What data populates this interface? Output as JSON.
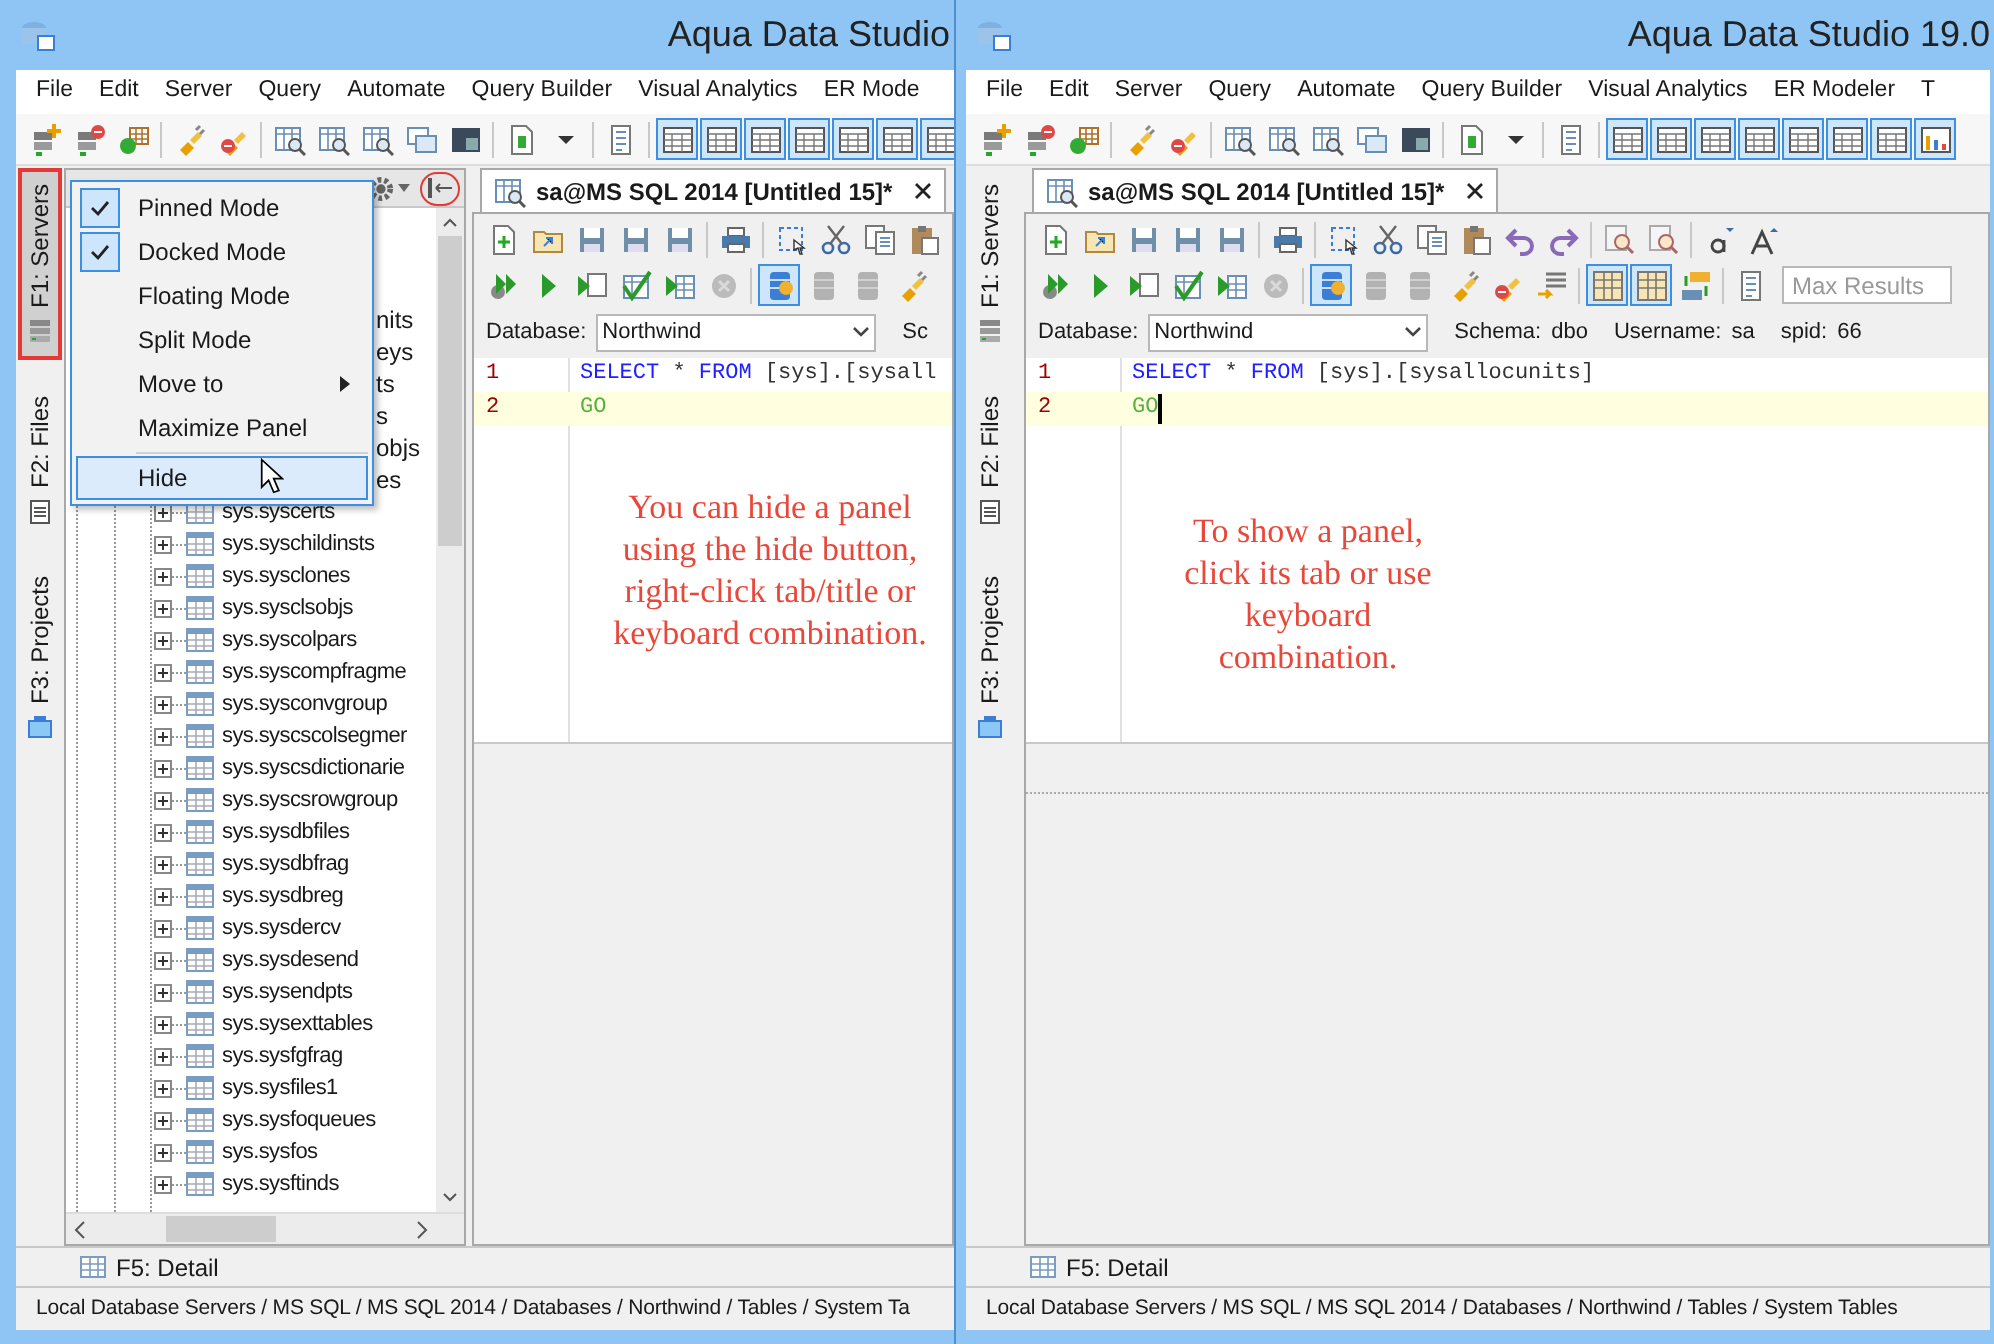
{
  "windows": [
    {
      "title": "Aqua Data Studio",
      "menu": [
        "File",
        "Edit",
        "Server",
        "Query",
        "Automate",
        "Query Builder",
        "Visual Analytics",
        "ER Mode"
      ],
      "toolbar": [
        {
          "kind": "server-add",
          "pressed": false
        },
        {
          "kind": "server-remove",
          "pressed": false
        },
        {
          "kind": "table-add",
          "pressed": false
        },
        {
          "kind": "separator"
        },
        {
          "kind": "connect",
          "pressed": false
        },
        {
          "kind": "disconnect",
          "pressed": false
        },
        {
          "kind": "separator"
        },
        {
          "kind": "query",
          "pressed": false
        },
        {
          "kind": "query",
          "pressed": false
        },
        {
          "kind": "query",
          "pressed": false
        },
        {
          "kind": "windows",
          "pressed": false
        },
        {
          "kind": "console",
          "pressed": false
        },
        {
          "kind": "separator"
        },
        {
          "kind": "document",
          "pressed": false
        },
        {
          "kind": "caret",
          "pressed": false
        },
        {
          "kind": "separator"
        },
        {
          "kind": "script",
          "pressed": false
        },
        {
          "kind": "separator"
        },
        {
          "kind": "layout",
          "pressed": true
        },
        {
          "kind": "layout",
          "pressed": true
        },
        {
          "kind": "layout",
          "pressed": true
        },
        {
          "kind": "layout",
          "pressed": true
        },
        {
          "kind": "layout",
          "pressed": true
        },
        {
          "kind": "layout",
          "pressed": true
        },
        {
          "kind": "layout",
          "pressed": true
        }
      ],
      "side_tabs": [
        {
          "label": "F1: Servers",
          "kind": "servers",
          "selected": true,
          "highlighted": true
        },
        {
          "label": "F2: Files",
          "kind": "files",
          "selected": false,
          "highlighted": false
        },
        {
          "label": "F3: Projects",
          "kind": "projects",
          "selected": false,
          "highlighted": false
        }
      ],
      "panel": {
        "hide_button": {
          "highlighted": true
        },
        "context_menu": [
          {
            "kind": "item",
            "label": "Pinned Mode",
            "checked": true,
            "selected": false
          },
          {
            "kind": "item",
            "label": "Docked Mode",
            "checked": true,
            "selected": false
          },
          {
            "kind": "item",
            "label": "Floating Mode",
            "checked": false,
            "selected": false
          },
          {
            "kind": "item",
            "label": "Split Mode",
            "checked": false,
            "selected": false
          },
          {
            "kind": "submenu",
            "label": "Move to",
            "checked": false,
            "selected": false
          },
          {
            "kind": "item",
            "label": "Maximize Panel",
            "checked": false,
            "selected": false
          },
          {
            "kind": "separator"
          },
          {
            "kind": "item",
            "label": "Hide",
            "checked": false,
            "selected": true
          }
        ],
        "tree": [
          {
            "kind": "clipped",
            "text": "nits"
          },
          {
            "kind": "clipped",
            "text": "eys"
          },
          {
            "kind": "clipped",
            "text": "ts"
          },
          {
            "kind": "clipped",
            "text": "s"
          },
          {
            "kind": "clipped",
            "text": "objs"
          },
          {
            "kind": "clipped",
            "text": "es"
          },
          {
            "kind": "table",
            "text": "sys.syscerts",
            "expanded": false
          },
          {
            "kind": "table",
            "text": "sys.syschildinsts",
            "expanded": false
          },
          {
            "kind": "table",
            "text": "sys.sysclones",
            "expanded": false
          },
          {
            "kind": "table",
            "text": "sys.sysclsobjs",
            "expanded": false
          },
          {
            "kind": "table",
            "text": "sys.syscolpars",
            "expanded": false
          },
          {
            "kind": "table",
            "text": "sys.syscompfragme",
            "expanded": false
          },
          {
            "kind": "table",
            "text": "sys.sysconvgroup",
            "expanded": false
          },
          {
            "kind": "table",
            "text": "sys.syscscolsegmer",
            "expanded": false
          },
          {
            "kind": "table",
            "text": "sys.syscsdictionarie",
            "expanded": false
          },
          {
            "kind": "table",
            "text": "sys.syscsrowgroup",
            "expanded": false
          },
          {
            "kind": "table",
            "text": "sys.sysdbfiles",
            "expanded": false
          },
          {
            "kind": "table",
            "text": "sys.sysdbfrag",
            "expanded": false
          },
          {
            "kind": "table",
            "text": "sys.sysdbreg",
            "expanded": false
          },
          {
            "kind": "table",
            "text": "sys.sysdercv",
            "expanded": false
          },
          {
            "kind": "table",
            "text": "sys.sysdesend",
            "expanded": false
          },
          {
            "kind": "table",
            "text": "sys.sysendpts",
            "expanded": false
          },
          {
            "kind": "table",
            "text": "sys.sysexttables",
            "expanded": false
          },
          {
            "kind": "table",
            "text": "sys.sysfgfrag",
            "expanded": false
          },
          {
            "kind": "table",
            "text": "sys.sysfiles1",
            "expanded": false
          },
          {
            "kind": "table",
            "text": "sys.sysfoqueues",
            "expanded": false
          },
          {
            "kind": "table",
            "text": "sys.sysfos",
            "expanded": false
          },
          {
            "kind": "table",
            "text": "sys.sysftinds",
            "expanded": false
          }
        ]
      },
      "editor": {
        "tab": "sa@MS SQL 2014 [Untitled 15]*",
        "toolbar_1": [
          {
            "kind": "file-add"
          },
          {
            "kind": "folder"
          },
          {
            "kind": "save"
          },
          {
            "kind": "save"
          },
          {
            "kind": "save"
          },
          {
            "kind": "separator"
          },
          {
            "kind": "print"
          },
          {
            "kind": "separator"
          },
          {
            "kind": "select"
          },
          {
            "kind": "cut"
          },
          {
            "kind": "copy"
          },
          {
            "kind": "paste"
          }
        ],
        "toolbar_2": [
          {
            "kind": "run-all",
            "pressed": false,
            "disabled": false
          },
          {
            "kind": "run",
            "pressed": false,
            "disabled": false
          },
          {
            "kind": "run-script",
            "pressed": false,
            "disabled": false
          },
          {
            "kind": "plan",
            "pressed": false,
            "disabled": false
          },
          {
            "kind": "run-grid",
            "pressed": false,
            "disabled": false
          },
          {
            "kind": "stop",
            "pressed": false,
            "disabled": true
          },
          {
            "kind": "separator"
          },
          {
            "kind": "transaction",
            "pressed": true,
            "disabled": false
          },
          {
            "kind": "commit",
            "pressed": false,
            "disabled": true
          },
          {
            "kind": "commit",
            "pressed": false,
            "disabled": true
          },
          {
            "kind": "connect",
            "pressed": false,
            "disabled": false
          }
        ],
        "database_label": "Database:",
        "database": "Northwind",
        "info": [
          {
            "label": "Sc"
          }
        ],
        "lines": [
          {
            "number": "1",
            "current": false,
            "tokens": [
              {
                "kind": "keyword",
                "text": "SELECT"
              },
              {
                "kind": "plain",
                "text": " * "
              },
              {
                "kind": "keyword",
                "text": "FROM"
              },
              {
                "kind": "plain",
                "text": " [sys].[sysall"
              }
            ]
          },
          {
            "number": "2",
            "current": true,
            "tokens": [
              {
                "kind": "batch",
                "text": "GO"
              }
            ]
          }
        ],
        "annotation": "You can hide a panel using the hide button, right-click tab/title or keyboard combination."
      },
      "detail_tab": "F5: Detail",
      "status_bar": "Local Database Servers / MS SQL / MS SQL 2014 / Databases / Northwind / Tables / System Ta"
    },
    {
      "title": "Aqua Data Studio 19.0",
      "menu": [
        "File",
        "Edit",
        "Server",
        "Query",
        "Automate",
        "Query Builder",
        "Visual Analytics",
        "ER Modeler",
        "T"
      ],
      "toolbar": [
        {
          "kind": "server-add",
          "pressed": false
        },
        {
          "kind": "server-remove",
          "pressed": false
        },
        {
          "kind": "table-add",
          "pressed": false
        },
        {
          "kind": "separator"
        },
        {
          "kind": "connect",
          "pressed": false
        },
        {
          "kind": "disconnect",
          "pressed": false
        },
        {
          "kind": "separator"
        },
        {
          "kind": "query",
          "pressed": false
        },
        {
          "kind": "query",
          "pressed": false
        },
        {
          "kind": "query",
          "pressed": false
        },
        {
          "kind": "windows",
          "pressed": false
        },
        {
          "kind": "console",
          "pressed": false
        },
        {
          "kind": "separator"
        },
        {
          "kind": "document",
          "pressed": false
        },
        {
          "kind": "caret",
          "pressed": false
        },
        {
          "kind": "separator"
        },
        {
          "kind": "script",
          "pressed": false
        },
        {
          "kind": "separator"
        },
        {
          "kind": "layout",
          "pressed": true
        },
        {
          "kind": "layout",
          "pressed": true
        },
        {
          "kind": "layout",
          "pressed": true
        },
        {
          "kind": "layout",
          "pressed": true
        },
        {
          "kind": "layout",
          "pressed": true
        },
        {
          "kind": "layout",
          "pressed": true
        },
        {
          "kind": "layout",
          "pressed": true
        },
        {
          "kind": "chart",
          "pressed": true
        }
      ],
      "side_tabs": [
        {
          "label": "F1: Servers",
          "kind": "servers",
          "selected": false,
          "highlighted": false
        },
        {
          "label": "F2: Files",
          "kind": "files",
          "selected": false,
          "highlighted": false
        },
        {
          "label": "F3: Projects",
          "kind": "projects",
          "selected": false,
          "highlighted": false
        }
      ],
      "editor": {
        "tab": "sa@MS SQL 2014 [Untitled 15]*",
        "toolbar_1": [
          {
            "kind": "file-add"
          },
          {
            "kind": "folder"
          },
          {
            "kind": "save"
          },
          {
            "kind": "save"
          },
          {
            "kind": "save"
          },
          {
            "kind": "separator"
          },
          {
            "kind": "print"
          },
          {
            "kind": "separator"
          },
          {
            "kind": "select"
          },
          {
            "kind": "cut"
          },
          {
            "kind": "copy"
          },
          {
            "kind": "paste"
          },
          {
            "kind": "undo"
          },
          {
            "kind": "redo"
          },
          {
            "kind": "separator"
          },
          {
            "kind": "find"
          },
          {
            "kind": "find"
          },
          {
            "kind": "separator"
          },
          {
            "kind": "font-smaller"
          },
          {
            "kind": "font-larger"
          }
        ],
        "toolbar_2": [
          {
            "kind": "run-all",
            "pressed": false,
            "disabled": false
          },
          {
            "kind": "run",
            "pressed": false,
            "disabled": false
          },
          {
            "kind": "run-script",
            "pressed": false,
            "disabled": false
          },
          {
            "kind": "plan",
            "pressed": false,
            "disabled": false
          },
          {
            "kind": "run-grid",
            "pressed": false,
            "disabled": false
          },
          {
            "kind": "stop",
            "pressed": false,
            "disabled": true
          },
          {
            "kind": "separator"
          },
          {
            "kind": "transaction",
            "pressed": true,
            "disabled": false
          },
          {
            "kind": "commit",
            "pressed": false,
            "disabled": true
          },
          {
            "kind": "commit",
            "pressed": false,
            "disabled": true
          },
          {
            "kind": "connect",
            "pressed": false,
            "disabled": false
          },
          {
            "kind": "disconnect",
            "pressed": false,
            "disabled": false
          },
          {
            "kind": "history",
            "pressed": false,
            "disabled": false
          },
          {
            "kind": "separator"
          },
          {
            "kind": "grid-view",
            "pressed": true,
            "disabled": false
          },
          {
            "kind": "grid-view",
            "pressed": true,
            "disabled": false
          },
          {
            "kind": "swap",
            "pressed": false,
            "disabled": false
          },
          {
            "kind": "separator"
          },
          {
            "kind": "script",
            "pressed": false,
            "disabled": false
          }
        ],
        "max_results": {
          "placeholder": "Max Results"
        },
        "database_label": "Database:",
        "database": "Northwind",
        "info": [
          {
            "label": "Schema:",
            "value": "dbo"
          },
          {
            "label": "Username:",
            "value": "sa"
          },
          {
            "label": "spid:",
            "value": "66"
          }
        ],
        "lines": [
          {
            "number": "1",
            "current": false,
            "tokens": [
              {
                "kind": "keyword",
                "text": "SELECT"
              },
              {
                "kind": "plain",
                "text": " * "
              },
              {
                "kind": "keyword",
                "text": "FROM"
              },
              {
                "kind": "plain",
                "text": " [sys].[sysallocunits]"
              }
            ]
          },
          {
            "number": "2",
            "current": true,
            "tokens": [
              {
                "kind": "batch",
                "text": "GO"
              }
            ]
          }
        ],
        "annotation": "To show a panel, click its tab or use keyboard combination."
      },
      "detail_tab": "F5: Detail",
      "status_bar": "Local Database Servers / MS SQL / MS SQL 2014 / Databases / Northwind / Tables / System Tables"
    }
  ]
}
